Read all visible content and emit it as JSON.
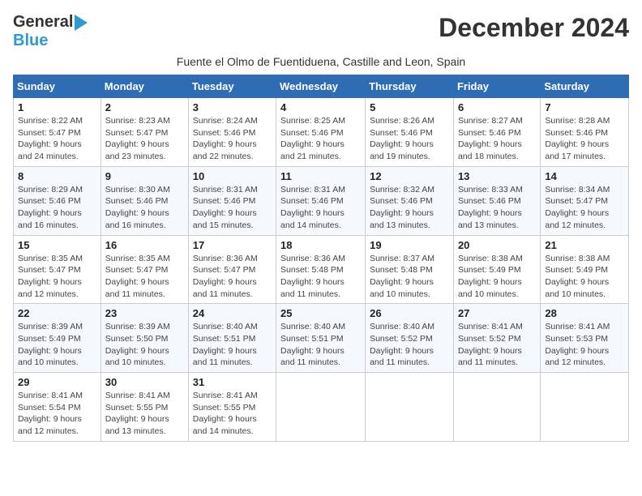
{
  "logo": {
    "line1": "General",
    "line2": "Blue"
  },
  "title": "December 2024",
  "subtitle": "Fuente el Olmo de Fuentiduena, Castille and Leon, Spain",
  "weekdays": [
    "Sunday",
    "Monday",
    "Tuesday",
    "Wednesday",
    "Thursday",
    "Friday",
    "Saturday"
  ],
  "weeks": [
    [
      {
        "day": "1",
        "sunrise": "8:22 AM",
        "sunset": "5:47 PM",
        "daylight": "9 hours and 24 minutes."
      },
      {
        "day": "2",
        "sunrise": "8:23 AM",
        "sunset": "5:47 PM",
        "daylight": "9 hours and 23 minutes."
      },
      {
        "day": "3",
        "sunrise": "8:24 AM",
        "sunset": "5:46 PM",
        "daylight": "9 hours and 22 minutes."
      },
      {
        "day": "4",
        "sunrise": "8:25 AM",
        "sunset": "5:46 PM",
        "daylight": "9 hours and 21 minutes."
      },
      {
        "day": "5",
        "sunrise": "8:26 AM",
        "sunset": "5:46 PM",
        "daylight": "9 hours and 19 minutes."
      },
      {
        "day": "6",
        "sunrise": "8:27 AM",
        "sunset": "5:46 PM",
        "daylight": "9 hours and 18 minutes."
      },
      {
        "day": "7",
        "sunrise": "8:28 AM",
        "sunset": "5:46 PM",
        "daylight": "9 hours and 17 minutes."
      }
    ],
    [
      {
        "day": "8",
        "sunrise": "8:29 AM",
        "sunset": "5:46 PM",
        "daylight": "9 hours and 16 minutes."
      },
      {
        "day": "9",
        "sunrise": "8:30 AM",
        "sunset": "5:46 PM",
        "daylight": "9 hours and 16 minutes."
      },
      {
        "day": "10",
        "sunrise": "8:31 AM",
        "sunset": "5:46 PM",
        "daylight": "9 hours and 15 minutes."
      },
      {
        "day": "11",
        "sunrise": "8:31 AM",
        "sunset": "5:46 PM",
        "daylight": "9 hours and 14 minutes."
      },
      {
        "day": "12",
        "sunrise": "8:32 AM",
        "sunset": "5:46 PM",
        "daylight": "9 hours and 13 minutes."
      },
      {
        "day": "13",
        "sunrise": "8:33 AM",
        "sunset": "5:46 PM",
        "daylight": "9 hours and 13 minutes."
      },
      {
        "day": "14",
        "sunrise": "8:34 AM",
        "sunset": "5:47 PM",
        "daylight": "9 hours and 12 minutes."
      }
    ],
    [
      {
        "day": "15",
        "sunrise": "8:35 AM",
        "sunset": "5:47 PM",
        "daylight": "9 hours and 12 minutes."
      },
      {
        "day": "16",
        "sunrise": "8:35 AM",
        "sunset": "5:47 PM",
        "daylight": "9 hours and 11 minutes."
      },
      {
        "day": "17",
        "sunrise": "8:36 AM",
        "sunset": "5:47 PM",
        "daylight": "9 hours and 11 minutes."
      },
      {
        "day": "18",
        "sunrise": "8:36 AM",
        "sunset": "5:48 PM",
        "daylight": "9 hours and 11 minutes."
      },
      {
        "day": "19",
        "sunrise": "8:37 AM",
        "sunset": "5:48 PM",
        "daylight": "9 hours and 10 minutes."
      },
      {
        "day": "20",
        "sunrise": "8:38 AM",
        "sunset": "5:49 PM",
        "daylight": "9 hours and 10 minutes."
      },
      {
        "day": "21",
        "sunrise": "8:38 AM",
        "sunset": "5:49 PM",
        "daylight": "9 hours and 10 minutes."
      }
    ],
    [
      {
        "day": "22",
        "sunrise": "8:39 AM",
        "sunset": "5:49 PM",
        "daylight": "9 hours and 10 minutes."
      },
      {
        "day": "23",
        "sunrise": "8:39 AM",
        "sunset": "5:50 PM",
        "daylight": "9 hours and 10 minutes."
      },
      {
        "day": "24",
        "sunrise": "8:40 AM",
        "sunset": "5:51 PM",
        "daylight": "9 hours and 11 minutes."
      },
      {
        "day": "25",
        "sunrise": "8:40 AM",
        "sunset": "5:51 PM",
        "daylight": "9 hours and 11 minutes."
      },
      {
        "day": "26",
        "sunrise": "8:40 AM",
        "sunset": "5:52 PM",
        "daylight": "9 hours and 11 minutes."
      },
      {
        "day": "27",
        "sunrise": "8:41 AM",
        "sunset": "5:52 PM",
        "daylight": "9 hours and 11 minutes."
      },
      {
        "day": "28",
        "sunrise": "8:41 AM",
        "sunset": "5:53 PM",
        "daylight": "9 hours and 12 minutes."
      }
    ],
    [
      {
        "day": "29",
        "sunrise": "8:41 AM",
        "sunset": "5:54 PM",
        "daylight": "9 hours and 12 minutes."
      },
      {
        "day": "30",
        "sunrise": "8:41 AM",
        "sunset": "5:55 PM",
        "daylight": "9 hours and 13 minutes."
      },
      {
        "day": "31",
        "sunrise": "8:41 AM",
        "sunset": "5:55 PM",
        "daylight": "9 hours and 14 minutes."
      },
      null,
      null,
      null,
      null
    ]
  ]
}
